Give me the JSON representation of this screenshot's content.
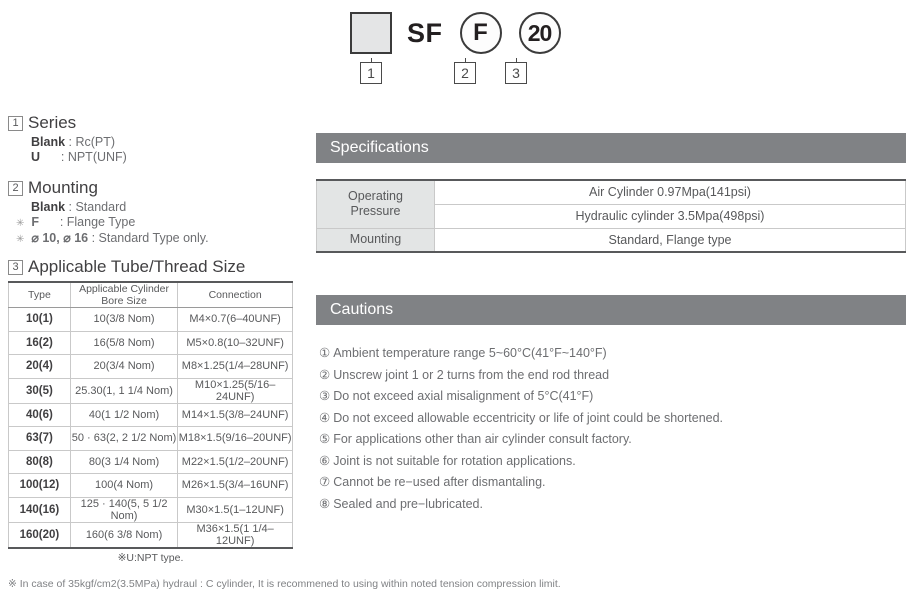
{
  "code_diagram": {
    "square_label": "",
    "series_text": "SF",
    "circle_2": "F",
    "circle_3": "20",
    "marker_1": "1",
    "marker_2": "2",
    "marker_3": "3"
  },
  "left": {
    "series": {
      "number": "1",
      "title": "Series",
      "options": [
        "Blank : Rc(PT)",
        "U      : NPT(UNF)"
      ]
    },
    "mounting": {
      "number": "2",
      "title": "Mounting",
      "option_main": "Blank : Standard",
      "bullets": [
        "F       : Flange Type",
        "ϕ 10, ϕ 16 : Standard Type only."
      ]
    },
    "tube": {
      "number": "3",
      "title": "Applicable Tube/Thread Size",
      "columns": [
        "Type",
        "Applicable Cylinder Bore Size",
        "Connection"
      ],
      "rows": [
        [
          "10(1)",
          "10(3/8 Nom)",
          "M4×0.7(6–40UNF)"
        ],
        [
          "16(2)",
          "16(5/8 Nom)",
          "M5×0.8(10–32UNF)"
        ],
        [
          "20(4)",
          "20(3/4 Nom)",
          "M8×1.25(1/4–28UNF)"
        ],
        [
          "30(5)",
          "25.30(1, 1 1/4 Nom)",
          "M10×1.25(5/16–24UNF)"
        ],
        [
          "40(6)",
          "40(1 1/2 Nom)",
          "M14×1.5(3/8–24UNF)"
        ],
        [
          "63(7)",
          "50 · 63(2, 2 1/2 Nom)",
          "M18×1.5(9/16–20UNF)"
        ],
        [
          "80(8)",
          "80(3 1/4 Nom)",
          "M22×1.5(1/2–20UNF)"
        ],
        [
          "100(12)",
          "100(4 Nom)",
          "M26×1.5(3/4–16UNF)"
        ],
        [
          "140(16)",
          "125 · 140(5, 5 1/2 Nom)",
          "M30×1.5(1–12UNF)"
        ],
        [
          "160(20)",
          "160(6 3/8 Nom)",
          "M36×1.5(1 1/4–12UNF)"
        ]
      ],
      "note": "※U:NPT type."
    }
  },
  "right": {
    "specifications": {
      "title": "Specifications",
      "rows": [
        {
          "label": "Operating\nPressure",
          "value": "Air Cylinder 0.97Mpa(141psi)"
        },
        {
          "label": "",
          "value": "Hydraulic cylinder 3.5Mpa(498psi)"
        },
        {
          "label": "Mounting",
          "value": "Standard, Flange type"
        }
      ],
      "label_operating_pressure_line1": "Operating",
      "label_operating_pressure_line2": "Pressure",
      "value_air": "Air Cylinder 0.97Mpa(141psi)",
      "value_hydraulic": "Hydraulic cylinder 3.5Mpa(498psi)",
      "label_mounting": "Mounting",
      "value_mounting": "Standard, Flange type"
    },
    "cautions": {
      "title": "Cautions",
      "items": [
        {
          "num": "①",
          "text": "Ambient temperature range 5~60°C(41°F~140°F)"
        },
        {
          "num": "②",
          "text": "Unscrew joint 1 or 2 turns from the end rod thread"
        },
        {
          "num": "③",
          "text": "Do not exceed axial misalignment of 5°C(41°F)"
        },
        {
          "num": "④",
          "text": "Do not exceed allowable eccentricity or life of joint could be shortened."
        },
        {
          "num": "⑤",
          "text": "For applications other than air cylinder consult factory."
        },
        {
          "num": "⑥",
          "text": "Joint is not suitable for rotation applications."
        },
        {
          "num": "⑦",
          "text": "Cannot be re−used after dismantaling."
        },
        {
          "num": "⑧",
          "text": "Sealed and pre−lubricated."
        }
      ]
    }
  },
  "footer_note": "※ In case of 35kgf/cm2(3.5MPa) hydraul : C cylinder, It is recommened to using within noted tension compression limit.",
  "colors": {
    "bar_gray": "#808285",
    "label_cell_gray": "#e3e5e5",
    "square_fill": "#e4e5e6",
    "text_gray": "#58595b"
  }
}
